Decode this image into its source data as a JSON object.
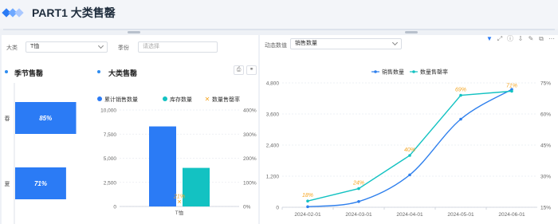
{
  "header": {
    "title": "PART1 大类售罄"
  },
  "filters": {
    "category_label": "大类",
    "category_value": "T恤",
    "season_label": "季份",
    "season_placeholder": "请选择"
  },
  "season_panel": {
    "title": "季节售罄"
  },
  "category_panel": {
    "title": "大类售罄"
  },
  "dynamic": {
    "label": "动态数值",
    "value": "销售数量"
  },
  "colors": {
    "blue": "#2b7bf5",
    "teal": "#13c2c2",
    "orange": "#f5a623",
    "line_blue": "#2f80ed"
  },
  "chart_data": [
    {
      "type": "bar",
      "title": "季节售罄",
      "orientation": "horizontal",
      "categories": [
        "春",
        "夏"
      ],
      "values": [
        85,
        71
      ],
      "value_labels": [
        "85%",
        "71%"
      ]
    },
    {
      "type": "bar",
      "title": "大类售罄",
      "categories": [
        "T恤"
      ],
      "series": [
        {
          "name": "累计销售数量",
          "values": [
            8300
          ]
        },
        {
          "name": "库存数量",
          "values": [
            4000
          ]
        },
        {
          "name": "数量售罄率",
          "values": [
            21
          ],
          "axis": "right"
        }
      ],
      "point_label": "21%",
      "y_ticks": [
        "0",
        "2,500",
        "5,000",
        "7,500",
        "10,000"
      ],
      "y2_ticks": [
        "0%",
        "100%",
        "200%",
        "300%",
        "400%"
      ],
      "ylim": [
        0,
        10000
      ],
      "y2lim": [
        0,
        400
      ]
    },
    {
      "type": "line",
      "x": [
        "2024-02-01",
        "2024-03-01",
        "2024-04-01",
        "2024-05-01",
        "2024-06-01"
      ],
      "series": [
        {
          "name": "销售数量",
          "values": [
            20,
            220,
            1250,
            3400,
            4550
          ],
          "axis": "left"
        },
        {
          "name": "数量售罄率",
          "values": [
            18,
            24,
            40,
            69,
            71
          ],
          "axis": "right",
          "labels": [
            "18%",
            "24%",
            "40%",
            "69%",
            "71%"
          ]
        }
      ],
      "y_ticks": [
        "0",
        "1,200",
        "2,400",
        "3,600",
        "4,800"
      ],
      "y2_ticks": [
        "15%",
        "30%",
        "45%",
        "60%",
        "75%"
      ],
      "ylim": [
        0,
        4800
      ],
      "y2lim": [
        15,
        75
      ]
    }
  ]
}
